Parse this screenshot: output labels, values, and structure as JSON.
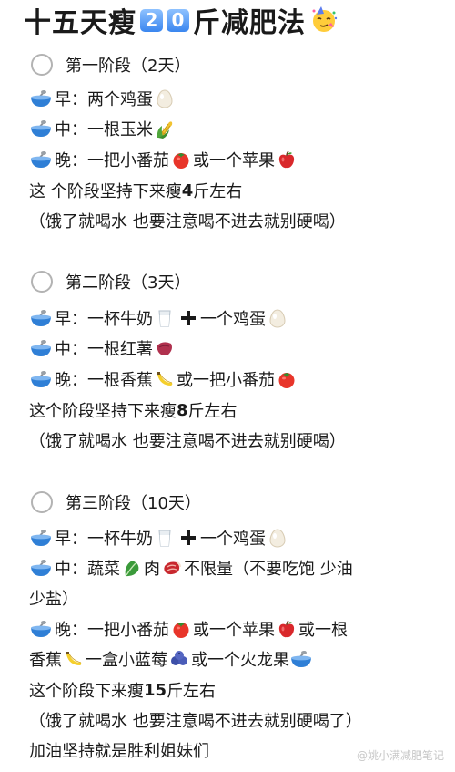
{
  "title": {
    "prefix": "十五天瘦",
    "num1": "2",
    "num2": "0",
    "suffix": "斤减肥法"
  },
  "stages": [
    {
      "header": "第一阶段（2天）",
      "breakfast_label": "早：",
      "breakfast_text": "两个鸡蛋",
      "lunch_label": "中：",
      "lunch_text": "一根玉米",
      "dinner_label": "晚：",
      "dinner_text1": "一把小番茄",
      "dinner_text2": "或一个苹果",
      "result_a": "这 个阶段坚持下来瘦",
      "result_num": "4",
      "result_b": "斤左右",
      "note": "（饿了就喝水 也要注意喝不进去就别硬喝）"
    },
    {
      "header": "第二阶段（3天）",
      "breakfast_label": "早：",
      "breakfast_text1": "一杯牛奶",
      "breakfast_text2": "一个鸡蛋",
      "lunch_label": "中：",
      "lunch_text": "一根红薯",
      "dinner_label": "晚：",
      "dinner_text1": "一根香蕉",
      "dinner_text2": "或一把小番茄",
      "result_a": "这个阶段坚持下来瘦",
      "result_num": "8",
      "result_b": "斤左右",
      "note": "（饿了就喝水 也要注意喝不进去就别硬喝）"
    },
    {
      "header": "第三阶段（10天）",
      "breakfast_label": "早：",
      "breakfast_text1": "一杯牛奶",
      "breakfast_text2": "一个鸡蛋",
      "lunch_label": "中：",
      "lunch_text1": "蔬菜",
      "lunch_text2": "肉",
      "lunch_text3": "不限量（不要吃饱 少油",
      "lunch_text4": "少盐）",
      "dinner_label": "晚：",
      "dinner_text1": "一把小番茄",
      "dinner_text2": "或一个苹果",
      "dinner_text3": "或一根",
      "dinner_text4": "香蕉",
      "dinner_text5": "一盒小蓝莓",
      "dinner_text6": "或一个火龙果",
      "result_a": "这个阶段下来瘦",
      "result_num": "15",
      "result_b": "斤左右",
      "note": "（饿了就喝水 也要注意喝不进去就别硬喝了）"
    }
  ],
  "closing": "加油坚持就是胜利姐妹们",
  "watermark": "@姚小满减肥笔记",
  "icons": {
    "bowl": "bowl-with-spoon-icon",
    "egg": "egg-icon",
    "corn": "corn-icon",
    "tomato": "tomato-icon",
    "apple": "red-apple-icon",
    "milk": "glass-of-milk-icon",
    "plus": "heavy-plus-icon",
    "sweet_potato": "sweet-potato-icon",
    "banana": "banana-icon",
    "leafy_green": "leafy-green-icon",
    "meat": "meat-cut-icon",
    "blueberries": "blueberries-icon",
    "party_face": "partying-face-icon"
  },
  "colors": {
    "accent_blue": "#3a86ef",
    "tomato_red": "#e8352a",
    "text": "#1a1a1a"
  }
}
